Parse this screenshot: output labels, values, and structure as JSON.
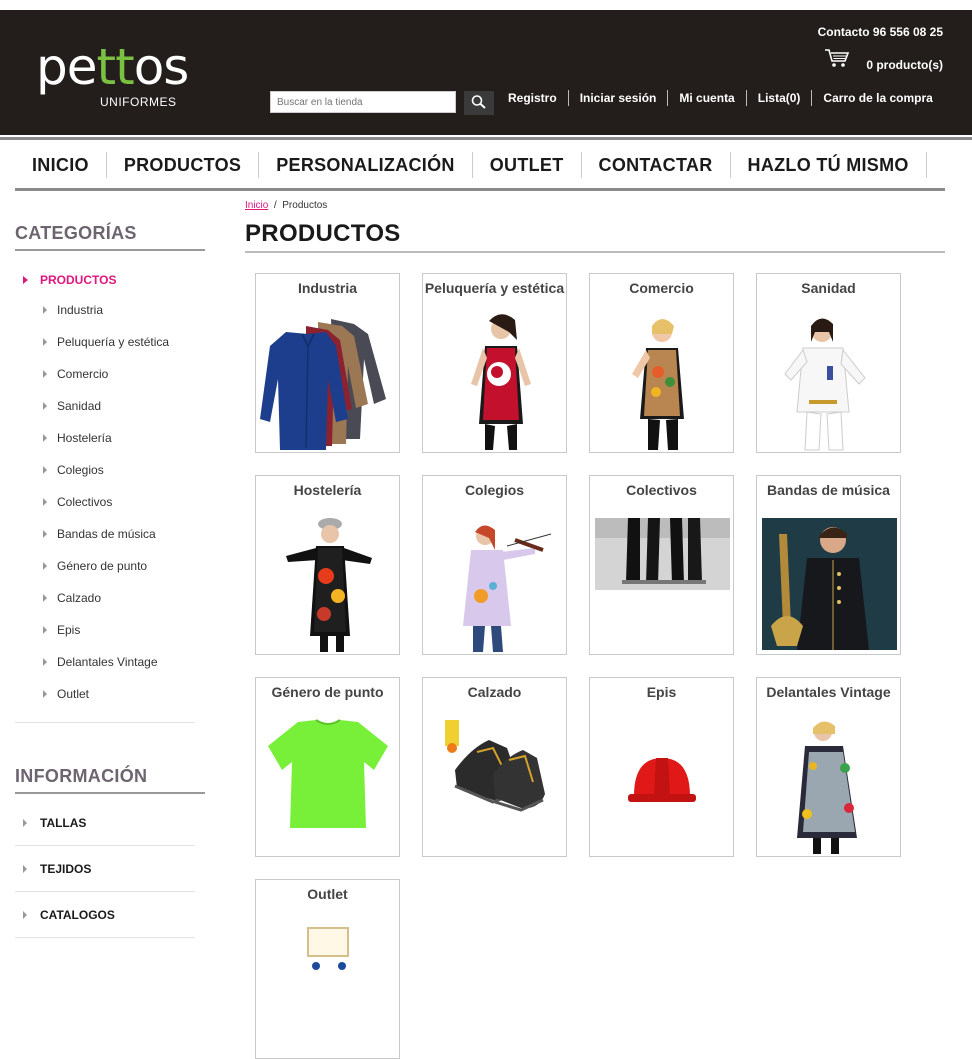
{
  "header": {
    "logo_main": "pettos",
    "logo_sub": "UNIFORMES",
    "contact": "Contacto 96 556 08 25",
    "cart_count": "0 producto(s)",
    "search_placeholder": "Buscar en la tienda",
    "links": [
      "Registro",
      "Iniciar sesión",
      "Mi cuenta",
      "Lista(0)",
      "Carro de la compra"
    ]
  },
  "nav": [
    "INICIO",
    "PRODUCTOS",
    "PERSONALIZACIÓN",
    "OUTLET",
    "CONTACTAR",
    "HAZLO TÚ MISMO"
  ],
  "sidebar": {
    "categories_title": "CATEGORÍAS",
    "main_category": "PRODUCTOS",
    "categories": [
      "Industria",
      "Peluquería y estética",
      "Comercio",
      "Sanidad",
      "Hostelería",
      "Colegios",
      "Colectivos",
      "Bandas de música",
      "Género de punto",
      "Calzado",
      "Epis",
      "Delantales Vintage",
      "Outlet"
    ],
    "info_title": "INFORMACIÓN",
    "info_items": [
      "TALLAS",
      "TEJIDOS",
      "CATALOGOS"
    ]
  },
  "breadcrumb": {
    "home": "Inicio",
    "sep": "/",
    "current": "Productos"
  },
  "page_title": "PRODUCTOS",
  "products": [
    {
      "label": "Industria",
      "icon": "workwear-coats-image"
    },
    {
      "label": "Peluquería y estética",
      "icon": "salon-apron-image"
    },
    {
      "label": "Comercio",
      "icon": "shop-apron-image"
    },
    {
      "label": "Sanidad",
      "icon": "medical-uniform-image"
    },
    {
      "label": "Hostelería",
      "icon": "hospitality-apron-image"
    },
    {
      "label": "Colegios",
      "icon": "school-smock-image"
    },
    {
      "label": "Colectivos",
      "icon": "group-uniform-image"
    },
    {
      "label": "Bandas de música",
      "icon": "band-uniform-image"
    },
    {
      "label": "Género de punto",
      "icon": "green-tshirt-image"
    },
    {
      "label": "Calzado",
      "icon": "safety-shoes-image"
    },
    {
      "label": "Epis",
      "icon": "red-helmet-image"
    },
    {
      "label": "Delantales Vintage",
      "icon": "vintage-apron-image"
    },
    {
      "label": "Outlet",
      "icon": "outlet-image"
    }
  ]
}
